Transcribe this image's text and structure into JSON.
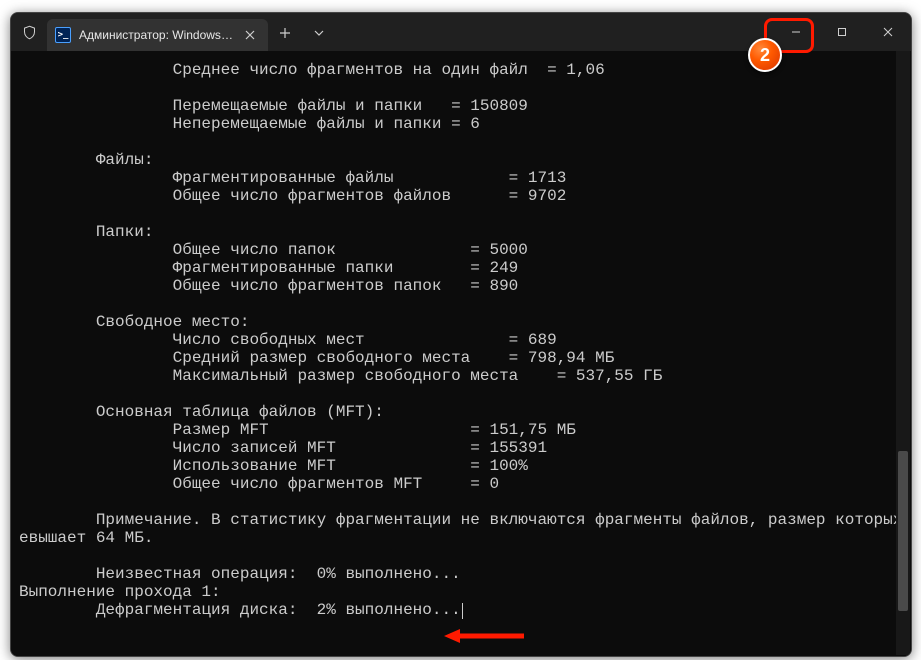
{
  "titlebar": {
    "tab_title": "Администратор: Windows Po",
    "newtab_tooltip": "+",
    "dropdown_tooltip": "˅",
    "min_tooltip": "Minimize",
    "max_tooltip": "Maximize",
    "close_tooltip": "Close"
  },
  "annotation": {
    "badge": "2"
  },
  "terminal": {
    "lines": [
      "                Среднее число фрагментов на один файл  = 1,06",
      "",
      "                Перемещаемые файлы и папки   = 150809",
      "                Неперемещаемые файлы и папки = 6",
      "",
      "        Файлы:",
      "                Фрагментированные файлы            = 1713",
      "                Общее число фрагментов файлов      = 9702",
      "",
      "        Папки:",
      "                Общее число папок              = 5000",
      "                Фрагментированные папки        = 249",
      "                Общее число фрагментов папок   = 890",
      "",
      "        Свободное место:",
      "                Число свободных мест               = 689",
      "                Средний размер свободного места    = 798,94 МБ",
      "                Максимальный размер свободного места    = 537,55 ГБ",
      "",
      "        Основная таблица файлов (MFT):",
      "                Размер MFT                     = 151,75 МБ",
      "                Число записей MFT              = 155391",
      "                Использование MFT              = 100%",
      "                Общее число фрагментов MFT     = 0",
      "",
      "        Примечание. В статистику фрагментации не включаются фрагменты файлов, размер которых пр",
      "евышает 64 МБ.",
      "",
      "        Неизвестная операция:  0% выполнено...",
      "Выполнение прохода 1:",
      "        Дефрагментация диска:  2% выполнено..."
    ]
  }
}
